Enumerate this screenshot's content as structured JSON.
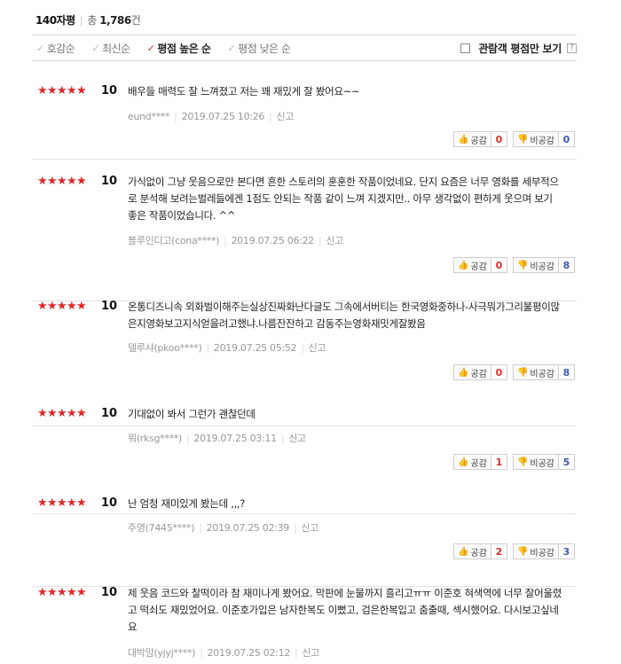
{
  "header": {
    "title": "140자평",
    "total_prefix": "총",
    "total_count": "1,786",
    "total_suffix": "건"
  },
  "sort": {
    "items": [
      {
        "label": "호감순",
        "active": false
      },
      {
        "label": "최신순",
        "active": false
      },
      {
        "label": "평점 높은 순",
        "active": true
      },
      {
        "label": "평점 낮은 순",
        "active": false
      }
    ],
    "viewer_only_label": "관람객 평점만 보기",
    "help_label": "?"
  },
  "buttons": {
    "like_label": "공감",
    "dislike_label": "비공감",
    "report_label": "신고"
  },
  "colors": {
    "star": "#e0262a",
    "like_count": "#d3312b",
    "dislike_count": "#3b5ab5"
  },
  "reviews": [
    {
      "score": "10",
      "text": "배우들 매력도 잘 느껴졌고 저는 꽤 재밌게 잘 봤어요~~",
      "author": "eund****",
      "date": "2019.07.25 10:26",
      "likes": "0",
      "dislikes": "0"
    },
    {
      "score": "10",
      "text": "가식없이 그냥 웃음으로만 본다면 흔한 스토리의 훈훈한 작품이었네요. 단지 요즘은 너무 영화를 세부적으로 분석해 보려는벌레들에겐 1점도 안되는 작품 같이 느껴 지겠지만.. 아무 생각없이 편하게 웃으며 보기 좋은 작품이었습니다. ^^",
      "author": "블루인디고(cona****)",
      "date": "2019.07.25 06:22",
      "likes": "0",
      "dislikes": "8"
    },
    {
      "score": "10",
      "text": "온통디즈니속 외화벌이해주는실상진짜화난다글도 그속에서버티는 한국영화중하나-사극뭐가그리불평이많은지영화보고지식얻을려고했냐.나름잔잔하고 감동주는영화재밋게잘봤음",
      "author": "델루샤(pkoo****)",
      "date": "2019.07.25 05:52",
      "likes": "0",
      "dislikes": "8"
    },
    {
      "score": "10",
      "text": "기대없이 봐서 그런가 괜찮던데",
      "author": "뭐(rksg****)",
      "date": "2019.07.25 03:11",
      "likes": "1",
      "dislikes": "5"
    },
    {
      "score": "10",
      "text": "난 엄청 재미있게 봤는데 ,,,?",
      "author": "주영(7445****)",
      "date": "2019.07.25 02:39",
      "likes": "2",
      "dislikes": "3"
    },
    {
      "score": "10",
      "text": "제 웃음 코드와 찰떡이라 참 재미나게 봤어요. 막판에 눈물까지 흘리고ㅠㅠ 이준호 혀색역에 너무 잘어울렸고 떡쇠도 재밌었어요. 이준호가입은 남자한복도 이뻤고, 검은한복입고 춤출때, 섹시했어요. 다시보고싶네요",
      "author": "대박맘(yjyj****)",
      "date": "2019.07.25 02:12",
      "likes": "",
      "dislikes": ""
    }
  ]
}
